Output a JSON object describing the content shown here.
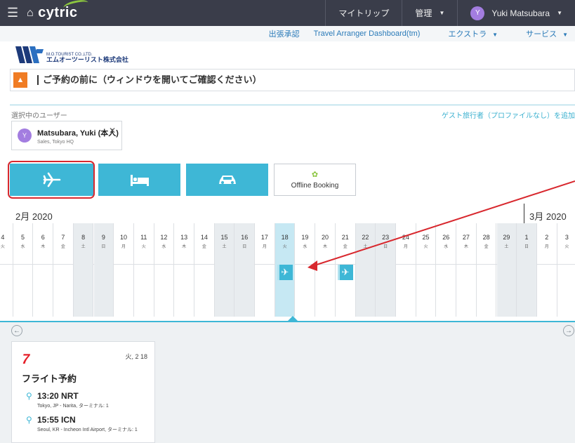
{
  "header": {
    "brand": "cytric",
    "nav": [
      {
        "label": "マイトリップ"
      },
      {
        "label": "管理"
      },
      {
        "label": "Yuki Matsubara",
        "avatar": "Y"
      }
    ]
  },
  "subnav": {
    "items": [
      "出張承認",
      "Travel Arranger Dashboard(tm)",
      "エクストラ",
      "サービス"
    ]
  },
  "company": {
    "name_en": "M.O.TOURIST CO.,LTD.",
    "name_jp": "エムオーツーリスト株式会社"
  },
  "notice": {
    "text": "ご予約の前に（ウィンドウを開いてご確認ください）"
  },
  "traveler": {
    "section_label": "選択中のユーザー",
    "guest_link": "ゲスト旅行者（プロファイルなし）を追加",
    "name": "Matsubara, Yuki (本人)",
    "dept": "Sales, Tokyo HQ",
    "avatar": "Y"
  },
  "booking_types": {
    "flight": {
      "icon": "airplane-icon"
    },
    "hotel": {
      "icon": "bed-icon"
    },
    "car": {
      "icon": "car-icon"
    },
    "offline": {
      "label": "Offline Booking",
      "icon": "offline-icon"
    }
  },
  "timeline": {
    "months": [
      "2月 2020",
      "3月 2020"
    ],
    "days": [
      {
        "n": "4",
        "w": "火"
      },
      {
        "n": "5",
        "w": "水"
      },
      {
        "n": "6",
        "w": "木"
      },
      {
        "n": "7",
        "w": "金"
      },
      {
        "n": "8",
        "w": "土"
      },
      {
        "n": "9",
        "w": "日"
      },
      {
        "n": "10",
        "w": "月"
      },
      {
        "n": "11",
        "w": "火"
      },
      {
        "n": "12",
        "w": "水"
      },
      {
        "n": "13",
        "w": "木"
      },
      {
        "n": "14",
        "w": "金"
      },
      {
        "n": "15",
        "w": "土"
      },
      {
        "n": "16",
        "w": "日"
      },
      {
        "n": "17",
        "w": "月"
      },
      {
        "n": "18",
        "w": "火"
      },
      {
        "n": "19",
        "w": "水"
      },
      {
        "n": "20",
        "w": "木"
      },
      {
        "n": "21",
        "w": "金"
      },
      {
        "n": "22",
        "w": "土"
      },
      {
        "n": "23",
        "w": "日"
      },
      {
        "n": "24",
        "w": "月"
      },
      {
        "n": "25",
        "w": "火"
      },
      {
        "n": "26",
        "w": "水"
      },
      {
        "n": "27",
        "w": "木"
      },
      {
        "n": "28",
        "w": "金"
      },
      {
        "n": "29",
        "w": "土"
      },
      {
        "n": "1",
        "w": "日"
      },
      {
        "n": "2",
        "w": "月"
      },
      {
        "n": "3",
        "w": "火"
      }
    ],
    "trips_on": [
      "18",
      "21"
    ]
  },
  "trip_card": {
    "date": "火, 2 18",
    "title": "フライト予約",
    "departure": {
      "time": "13:20 NRT",
      "place": "Tokyo, JP - Narita, ターミナル: 1"
    },
    "arrival": {
      "time": "15:55 ICN",
      "place": "Seoul, KR - Incheon Intl Airport, ターミナル: 1"
    }
  }
}
